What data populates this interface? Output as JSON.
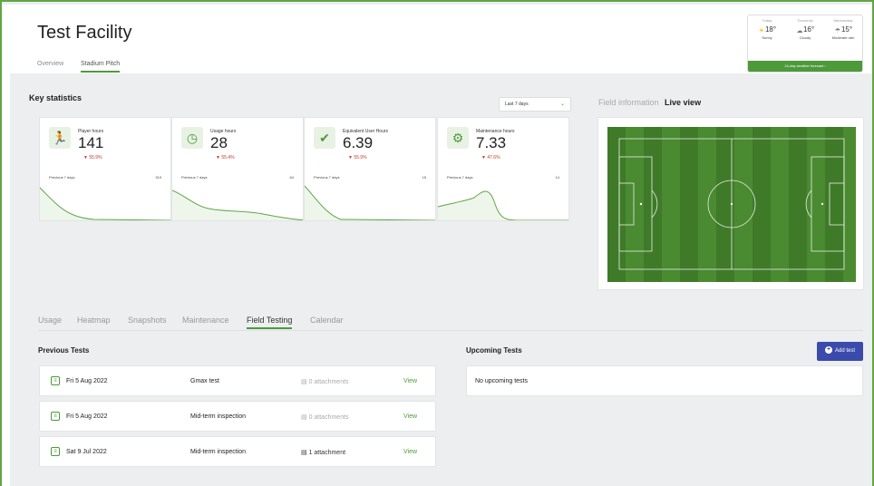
{
  "header": {
    "title": "Test Facility",
    "tabs": [
      "Overview",
      "Stadium Pitch"
    ]
  },
  "weather": {
    "days": [
      {
        "label": "Today",
        "temp": "18°",
        "condition": "Sunny"
      },
      {
        "label": "Tomorrow",
        "temp": "16°",
        "condition": "Cloudy"
      },
      {
        "label": "Wednesday",
        "temp": "15°",
        "condition": "Moderate rain"
      }
    ],
    "forecast_button": "14-day weather forecast ›"
  },
  "stats": {
    "title": "Key statistics",
    "period": "Last 7 days",
    "cards": [
      {
        "label": "Player hours",
        "value": "141",
        "delta": "▼ 55.9%",
        "prev_label": "Previous 7 days",
        "prev_value": "319",
        "icon": "runner-icon"
      },
      {
        "label": "Usage hours",
        "value": "28",
        "delta": "▼ 55.4%",
        "prev_label": "Previous 7 days",
        "prev_value": "64",
        "icon": "clock-icon"
      },
      {
        "label": "Equivalent User Hours",
        "value": "6.39",
        "delta": "▼ 55.9%",
        "prev_label": "Previous 7 days",
        "prev_value": "15",
        "icon": "shield-check-icon"
      },
      {
        "label": "Maintenance hours",
        "value": "7.33",
        "delta": "▼ 47.6%",
        "prev_label": "Previous 7 days",
        "prev_value": "14",
        "icon": "mower-icon"
      }
    ]
  },
  "field": {
    "tabs": [
      "Field information",
      "Live view"
    ]
  },
  "sections": {
    "tabs": [
      "Usage",
      "Heatmap",
      "Snapshots",
      "Maintenance",
      "Field Testing",
      "Calendar"
    ],
    "active": "Field Testing"
  },
  "tests": {
    "previous_title": "Previous Tests",
    "upcoming_title": "Upcoming Tests",
    "add_label": "Add test",
    "upcoming_empty": "No upcoming tests",
    "rows": [
      {
        "date": "Fri 5 Aug 2022",
        "name": "Gmax test",
        "attachments": "0 attachments",
        "view": "View"
      },
      {
        "date": "Fri 5 Aug 2022",
        "name": "Mid-term inspection",
        "attachments": "0 attachments",
        "view": "View"
      },
      {
        "date": "Sat 9 Jul 2022",
        "name": "Mid-term inspection",
        "attachments": "1 attachment",
        "view": "View"
      }
    ]
  },
  "colors": {
    "accent": "#4c9a3a",
    "primary_button": "#3a4bab",
    "negative": "#c0392b"
  }
}
